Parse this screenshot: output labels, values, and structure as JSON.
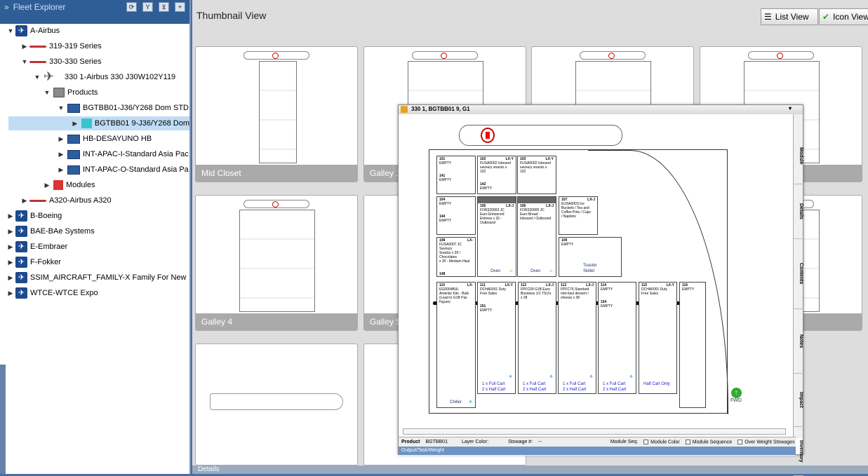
{
  "fleet_explorer": {
    "title": "Fleet Explorer",
    "tree": [
      {
        "label": "A-Airbus",
        "icon": "airline-icon",
        "toggle": "▼"
      },
      {
        "label": "319-319 Series",
        "icon": "aircraft-small-icon",
        "toggle": "▶"
      },
      {
        "label": "330-330 Series",
        "icon": "aircraft-small-icon",
        "toggle": "▼"
      },
      {
        "label": "330 1-Airbus 330 J30W102Y119",
        "icon": "aircraft-large-icon",
        "toggle": "▼"
      },
      {
        "label": "Products",
        "icon": "products-icon",
        "toggle": "▼"
      },
      {
        "label": "BGTBB01-J36/Y268 Dom STD",
        "icon": "book-icon",
        "toggle": "▼"
      },
      {
        "label": "BGTBB01 9-J36/Y268 Dom",
        "icon": "product-version-icon",
        "toggle": "▶",
        "selected": true
      },
      {
        "label": "HB-DESAYUNO HB",
        "icon": "book-icon",
        "toggle": "▶"
      },
      {
        "label": "INT-APAC-I-Standard Asia Pac",
        "icon": "book-icon",
        "toggle": "▶"
      },
      {
        "label": "INT-APAC-O-Standard Asia Pa",
        "icon": "book-icon",
        "toggle": "▶"
      },
      {
        "label": "Modules",
        "icon": "modules-icon",
        "toggle": "▶"
      },
      {
        "label": "A320-Airbus A320",
        "icon": "aircraft-small-icon",
        "toggle": "▶"
      },
      {
        "label": "B-Boeing",
        "icon": "airline-icon",
        "toggle": "▶"
      },
      {
        "label": "BAE-BAe Systems",
        "icon": "airline-icon",
        "toggle": "▶"
      },
      {
        "label": "E-Embraer",
        "icon": "airline-icon",
        "toggle": "▶"
      },
      {
        "label": "F-Fokker",
        "icon": "airline-icon",
        "toggle": "▶"
      },
      {
        "label": "SSIM_AIRCRAFT_FAMILY-X Family For New",
        "icon": "airline-icon",
        "toggle": "▶"
      },
      {
        "label": "WTCE-WTCE Expo",
        "icon": "airline-icon",
        "toggle": "▶"
      }
    ]
  },
  "thumbnail_view": {
    "title": "Thumbnail View",
    "list_view_label": "List View",
    "icon_view_label": "Icon View",
    "cards": [
      {
        "label": "Mid Closet"
      },
      {
        "label": "Galley 1"
      },
      {
        "label": ""
      },
      {
        "label": ""
      },
      {
        "label": "Galley 4"
      },
      {
        "label": "Galley 5"
      },
      {
        "label": ""
      },
      {
        "label": ""
      }
    ]
  },
  "dialog": {
    "title": "330 1, BGTBB01 9, G1",
    "side_tabs": [
      "Module",
      "Details",
      "Contents",
      "Notes",
      "Impact",
      "Inventory"
    ],
    "cells": [
      {
        "id": "101",
        "lines": [
          "EMPTY"
        ],
        "id2": "141",
        "lines2": [
          "EMPTY"
        ]
      },
      {
        "id": "102",
        "tag": "LX-Y",
        "lines": [
          "FUSA0002 Inbound",
          "savoury snacks x 102"
        ],
        "id2": "142",
        "lines2": [
          "EMPTY"
        ]
      },
      {
        "id": "103",
        "tag": "LX-Y",
        "lines": [
          "FUSA0002 Inbound",
          "savoury snacks x",
          "102"
        ]
      },
      {
        "id": "104",
        "lines": [
          "EMPTY"
        ],
        "id2": "144",
        "lines2": [
          "EMPTY"
        ]
      },
      {
        "id": "105",
        "tag": "LX-J",
        "lines": [
          "FOR320003 JC",
          "Euro Enhanced",
          "Entrees x 32 -",
          "Outbound"
        ],
        "footer": "Oven"
      },
      {
        "id": "106",
        "tag": "LX-J",
        "lines": [
          "FOR320005 JC",
          "Euro Bread -",
          "Inbound / Outbound"
        ],
        "footer": "Oven"
      },
      {
        "id": "107",
        "tag": "LX-J",
        "lines": [
          "EUSA0003 Ice",
          "Buckets / Tea and",
          "Coffee Pots / Cups",
          "/ Napkins"
        ]
      },
      {
        "id": "108",
        "tag": "LX-",
        "lines": [
          "FUSA0007 JC Savoury",
          "Snacks x 30 / Chocolates",
          "x 30 - Medium Haul"
        ],
        "id2": "148",
        "lines2": [
          "EMPTY"
        ]
      },
      {
        "id": "109",
        "lines": [
          "EMPTY"
        ],
        "footer1": "Toaster",
        "footer2": "Skillet"
      },
      {
        "id": "110",
        "tag": "LX-",
        "lines": [
          "EG0004BUL",
          "Amenity Kits - Bulk",
          "(Load to G1B Pax",
          "Figure)"
        ],
        "footer": "Chiller"
      },
      {
        "id": "111",
        "tag": "LX-Y",
        "lines": [
          "DCHA0001 Duty",
          "Free Sales"
        ],
        "id2": "151",
        "lines2": [
          "EMPTY"
        ],
        "carts": [
          "1 x Full Cart",
          "2 x Half Cart"
        ]
      },
      {
        "id": "112",
        "tag": "LX-J",
        "lines": [
          "FPFC09 G1B Euro",
          "Business 1/1 TSU's",
          "x 28"
        ],
        "carts": [
          "1 x Full Cart",
          "2 x Half Cart"
        ]
      },
      {
        "id": "113",
        "tag": "LX-J",
        "lines": [
          "FPFC76 Standard",
          "mid-haul dessert /",
          "cheese x 28"
        ],
        "carts": [
          "1 x Full Cart",
          "2 x Half Cart"
        ]
      },
      {
        "id": "114",
        "lines": [
          "EMPTY"
        ],
        "id2": "154",
        "lines2": [
          "EMPTY"
        ],
        "carts": [
          "1 x Full Cart",
          "2 x Half Cart"
        ]
      },
      {
        "id": "115",
        "tag": "LX-Y",
        "lines": [
          "DCHA0001 Duty",
          "Free Sales"
        ],
        "carts": [
          "Half Cart Only"
        ]
      },
      {
        "id": "116",
        "lines": [
          "EMPTY"
        ]
      }
    ],
    "fwd_label": "FWD",
    "footer": {
      "product_label": "Product",
      "product_value": "BGTBB01",
      "layer_color_label": "Layer Color:",
      "stowage_label": "Stowage #:",
      "stowage_value": "--",
      "module_seq_label": "Module Seq:",
      "checkbox_module_color": "Module Color",
      "checkbox_module_sequence": "Module Sequence",
      "checkbox_over_weight": "Over Weight Stowages",
      "bottom_bar": "Output/Task/Weight"
    }
  },
  "details_label": "Details"
}
